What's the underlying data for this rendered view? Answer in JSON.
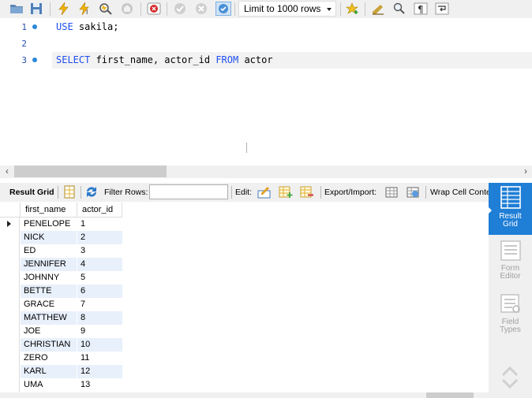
{
  "toolbar": {
    "limit_label": "Limit to 1000 rows",
    "icons": [
      "open-folder-icon",
      "save-icon",
      "execute-icon",
      "execute-current-icon",
      "explain-icon",
      "stop-icon",
      "toggle-error-icon",
      "commit-icon",
      "rollback-icon",
      "autocommit-icon",
      "add-snippet-icon",
      "beautify-icon",
      "find-icon",
      "invisible-chars-icon",
      "wrap-icon"
    ]
  },
  "editor": {
    "lines": [
      {
        "num": "1",
        "keyword": "USE",
        "rest": " sakila;"
      },
      {
        "num": "2"
      },
      {
        "num": "3",
        "keyword": "SELECT",
        "mid": " first_name, actor_id ",
        "keyword2": "FROM",
        "rest": " actor"
      }
    ]
  },
  "result_toolbar": {
    "result_grid": "Result Grid",
    "filter_rows": "Filter Rows:",
    "filter_value": "",
    "edit": "Edit:",
    "export_import": "Export/Import:",
    "wrap_cell": "Wrap Cell Content"
  },
  "grid": {
    "columns": [
      "first_name",
      "actor_id"
    ],
    "rows": [
      [
        "PENELOPE",
        "1"
      ],
      [
        "NICK",
        "2"
      ],
      [
        "ED",
        "3"
      ],
      [
        "JENNIFER",
        "4"
      ],
      [
        "JOHNNY",
        "5"
      ],
      [
        "BETTE",
        "6"
      ],
      [
        "GRACE",
        "7"
      ],
      [
        "MATTHEW",
        "8"
      ],
      [
        "JOE",
        "9"
      ],
      [
        "CHRISTIAN",
        "10"
      ],
      [
        "ZERO",
        "11"
      ],
      [
        "KARL",
        "12"
      ],
      [
        "UMA",
        "13"
      ]
    ]
  },
  "side_panel": {
    "result_grid_line1": "Result",
    "result_grid_line2": "Grid",
    "form_editor_line1": "Form",
    "form_editor_line2": "Editor",
    "field_types_line1": "Field",
    "field_types_line2": "Types"
  },
  "colors": {
    "accent": "#1f7ed6",
    "keyword": "#1f4ff0",
    "alt_row": "#e8f0fb"
  }
}
